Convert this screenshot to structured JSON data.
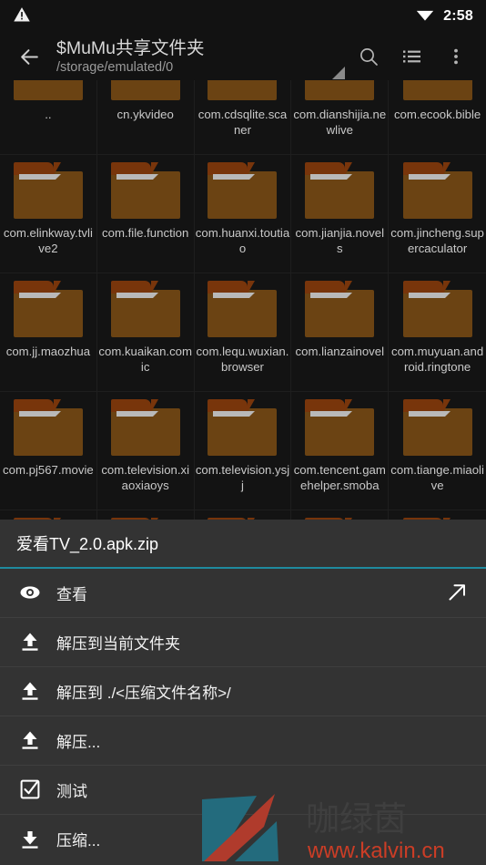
{
  "status_bar": {
    "warning_icon": "warning-triangle-icon",
    "wifi_icon": "wifi-icon",
    "time": "2:58"
  },
  "toolbar": {
    "back_icon": "arrow-left-icon",
    "title": "$MuMu共享文件夹",
    "subtitle": "/storage/emulated/0",
    "search_icon": "search-icon",
    "list_view_icon": "list-view-icon",
    "overflow_icon": "more-vertical-icon"
  },
  "file_grid": {
    "items": [
      {
        "name": "..",
        "type": "folder",
        "marked": true
      },
      {
        "name": "cn.ykvideo",
        "type": "folder",
        "marked": false
      },
      {
        "name": "com.cdsqlite.scaner",
        "type": "folder",
        "marked": false
      },
      {
        "name": "com.dianshijia.newlive",
        "type": "folder",
        "marked": false
      },
      {
        "name": "com.ecook.bible",
        "type": "folder",
        "marked": false
      },
      {
        "name": "com.elinkway.tvlive2",
        "type": "folder",
        "marked": false
      },
      {
        "name": "com.file.function",
        "type": "folder",
        "marked": false
      },
      {
        "name": "com.huanxi.toutiao",
        "type": "folder",
        "marked": false
      },
      {
        "name": "com.jianjia.novels",
        "type": "folder",
        "marked": false
      },
      {
        "name": "com.jincheng.supercaculator",
        "type": "folder",
        "marked": false
      },
      {
        "name": "com.jj.maozhua",
        "type": "folder",
        "marked": false
      },
      {
        "name": "com.kuaikan.comic",
        "type": "folder",
        "marked": false
      },
      {
        "name": "com.lequ.wuxian.browser",
        "type": "folder",
        "marked": false
      },
      {
        "name": "com.lianzainovel",
        "type": "folder",
        "marked": false
      },
      {
        "name": "com.muyuan.android.ringtone",
        "type": "folder",
        "marked": false
      },
      {
        "name": "com.pj567.movie",
        "type": "folder",
        "marked": false
      },
      {
        "name": "com.television.xiaoxiaoys",
        "type": "folder",
        "marked": false
      },
      {
        "name": "com.television.ysjj",
        "type": "folder",
        "marked": false
      },
      {
        "name": "com.tencent.gamehelper.smoba",
        "type": "folder",
        "marked": false
      },
      {
        "name": "com.tiange.miaolive",
        "type": "folder",
        "marked": false
      },
      {
        "name": "",
        "type": "folder",
        "marked": false
      },
      {
        "name": "",
        "type": "folder",
        "marked": false
      },
      {
        "name": "",
        "type": "folder",
        "marked": false
      },
      {
        "name": "",
        "type": "folder",
        "marked": false
      },
      {
        "name": "",
        "type": "folder",
        "marked": false
      }
    ]
  },
  "action_sheet": {
    "title": "爱看TV_2.0.apk.zip",
    "items": [
      {
        "label": "查看",
        "icon": "eye-icon",
        "trailing_icon": "open-external-icon"
      },
      {
        "label": "解压到当前文件夹",
        "icon": "extract-up-icon",
        "trailing_icon": ""
      },
      {
        "label": "解压到 ./<压缩文件名称>/",
        "icon": "extract-up-icon",
        "trailing_icon": ""
      },
      {
        "label": "解压...",
        "icon": "extract-up-icon",
        "trailing_icon": ""
      },
      {
        "label": "测试",
        "icon": "checkbox-checked-icon",
        "trailing_icon": ""
      },
      {
        "label": "压缩...",
        "icon": "compress-down-icon",
        "trailing_icon": ""
      }
    ]
  },
  "watermark": {
    "brand_text": "咖绿茵",
    "url_text": "www.kalvin.cn",
    "logo_icon": "kalvin-logo-icon",
    "teal_color": "#236b7d",
    "red_color": "#b03b2c"
  },
  "colors": {
    "background": "#131313",
    "toolbar": "#121212",
    "sheet": "#333333",
    "accent_teal": "#1f8a9e",
    "folder_body": "#6b4313",
    "folder_tab": "#78350b"
  }
}
